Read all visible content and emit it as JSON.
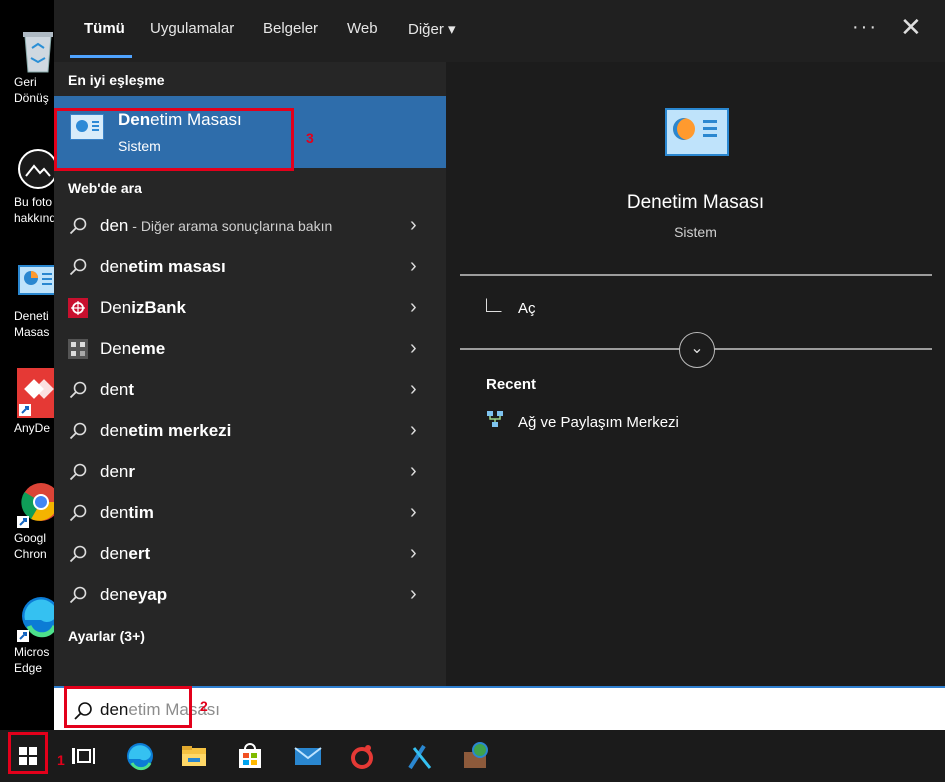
{
  "desktop": {
    "icons": [
      {
        "label": "Geri\nDönüş",
        "icon": "recycle-bin-icon"
      },
      {
        "label": "Bu foto\nhakkınd",
        "icon": "camera-icon"
      },
      {
        "label": "Deneti\nMasas",
        "icon": "control-panel-icon"
      },
      {
        "label": "AnyDe",
        "icon": "anydesk-icon"
      },
      {
        "label": "Googl\nChron",
        "icon": "chrome-icon"
      },
      {
        "label": "Micros\nEdge",
        "icon": "edge-icon"
      }
    ]
  },
  "tabs": [
    {
      "label": "Tümü",
      "active": true
    },
    {
      "label": "Uygulamalar"
    },
    {
      "label": "Belgeler"
    },
    {
      "label": "Web"
    },
    {
      "label": "Diğer ▾"
    }
  ],
  "header": {
    "more": "···",
    "close": "✕"
  },
  "best_match": {
    "section": "En iyi eşleşme",
    "title_bold": "Den",
    "title_rest": "etim Masası",
    "subtitle": "Sistem"
  },
  "web_section": "Web'de ara",
  "web_rows": [
    {
      "icon": "search-icon",
      "typed": "den",
      "rest": "",
      "hint": " - Diğer arama sonuçlarına bakın"
    },
    {
      "icon": "search-icon",
      "typed": "den",
      "rest": "etim masası",
      "hint": ""
    },
    {
      "icon": "denizbank-icon",
      "typed": "Den",
      "rest": "izBank",
      "hint": ""
    },
    {
      "icon": "deneme-icon",
      "typed": "Den",
      "rest": "eme",
      "hint": ""
    },
    {
      "icon": "search-icon",
      "typed": "den",
      "rest": "t",
      "hint": ""
    },
    {
      "icon": "search-icon",
      "typed": "den",
      "rest": "etim merkezi",
      "hint": ""
    },
    {
      "icon": "search-icon",
      "typed": "den",
      "rest": "r",
      "hint": ""
    },
    {
      "icon": "search-icon",
      "typed": "den",
      "rest": "tim",
      "hint": ""
    },
    {
      "icon": "search-icon",
      "typed": "den",
      "rest": "ert",
      "hint": ""
    },
    {
      "icon": "search-icon",
      "typed": "den",
      "rest": "eyap",
      "hint": ""
    }
  ],
  "settings_section": "Ayarlar (3+)",
  "preview": {
    "title": "Denetim Masası",
    "subtitle": "Sistem",
    "open_label": "Aç",
    "recent_label": "Recent",
    "recent_item": "Ağ ve Paylaşım Merkezi"
  },
  "search_box": {
    "typed": "den",
    "ghost": "etim Masası"
  },
  "annotations": [
    "1",
    "2",
    "3"
  ],
  "colors": {
    "accent": "#2e6dab",
    "annotation": "#e3001b"
  }
}
